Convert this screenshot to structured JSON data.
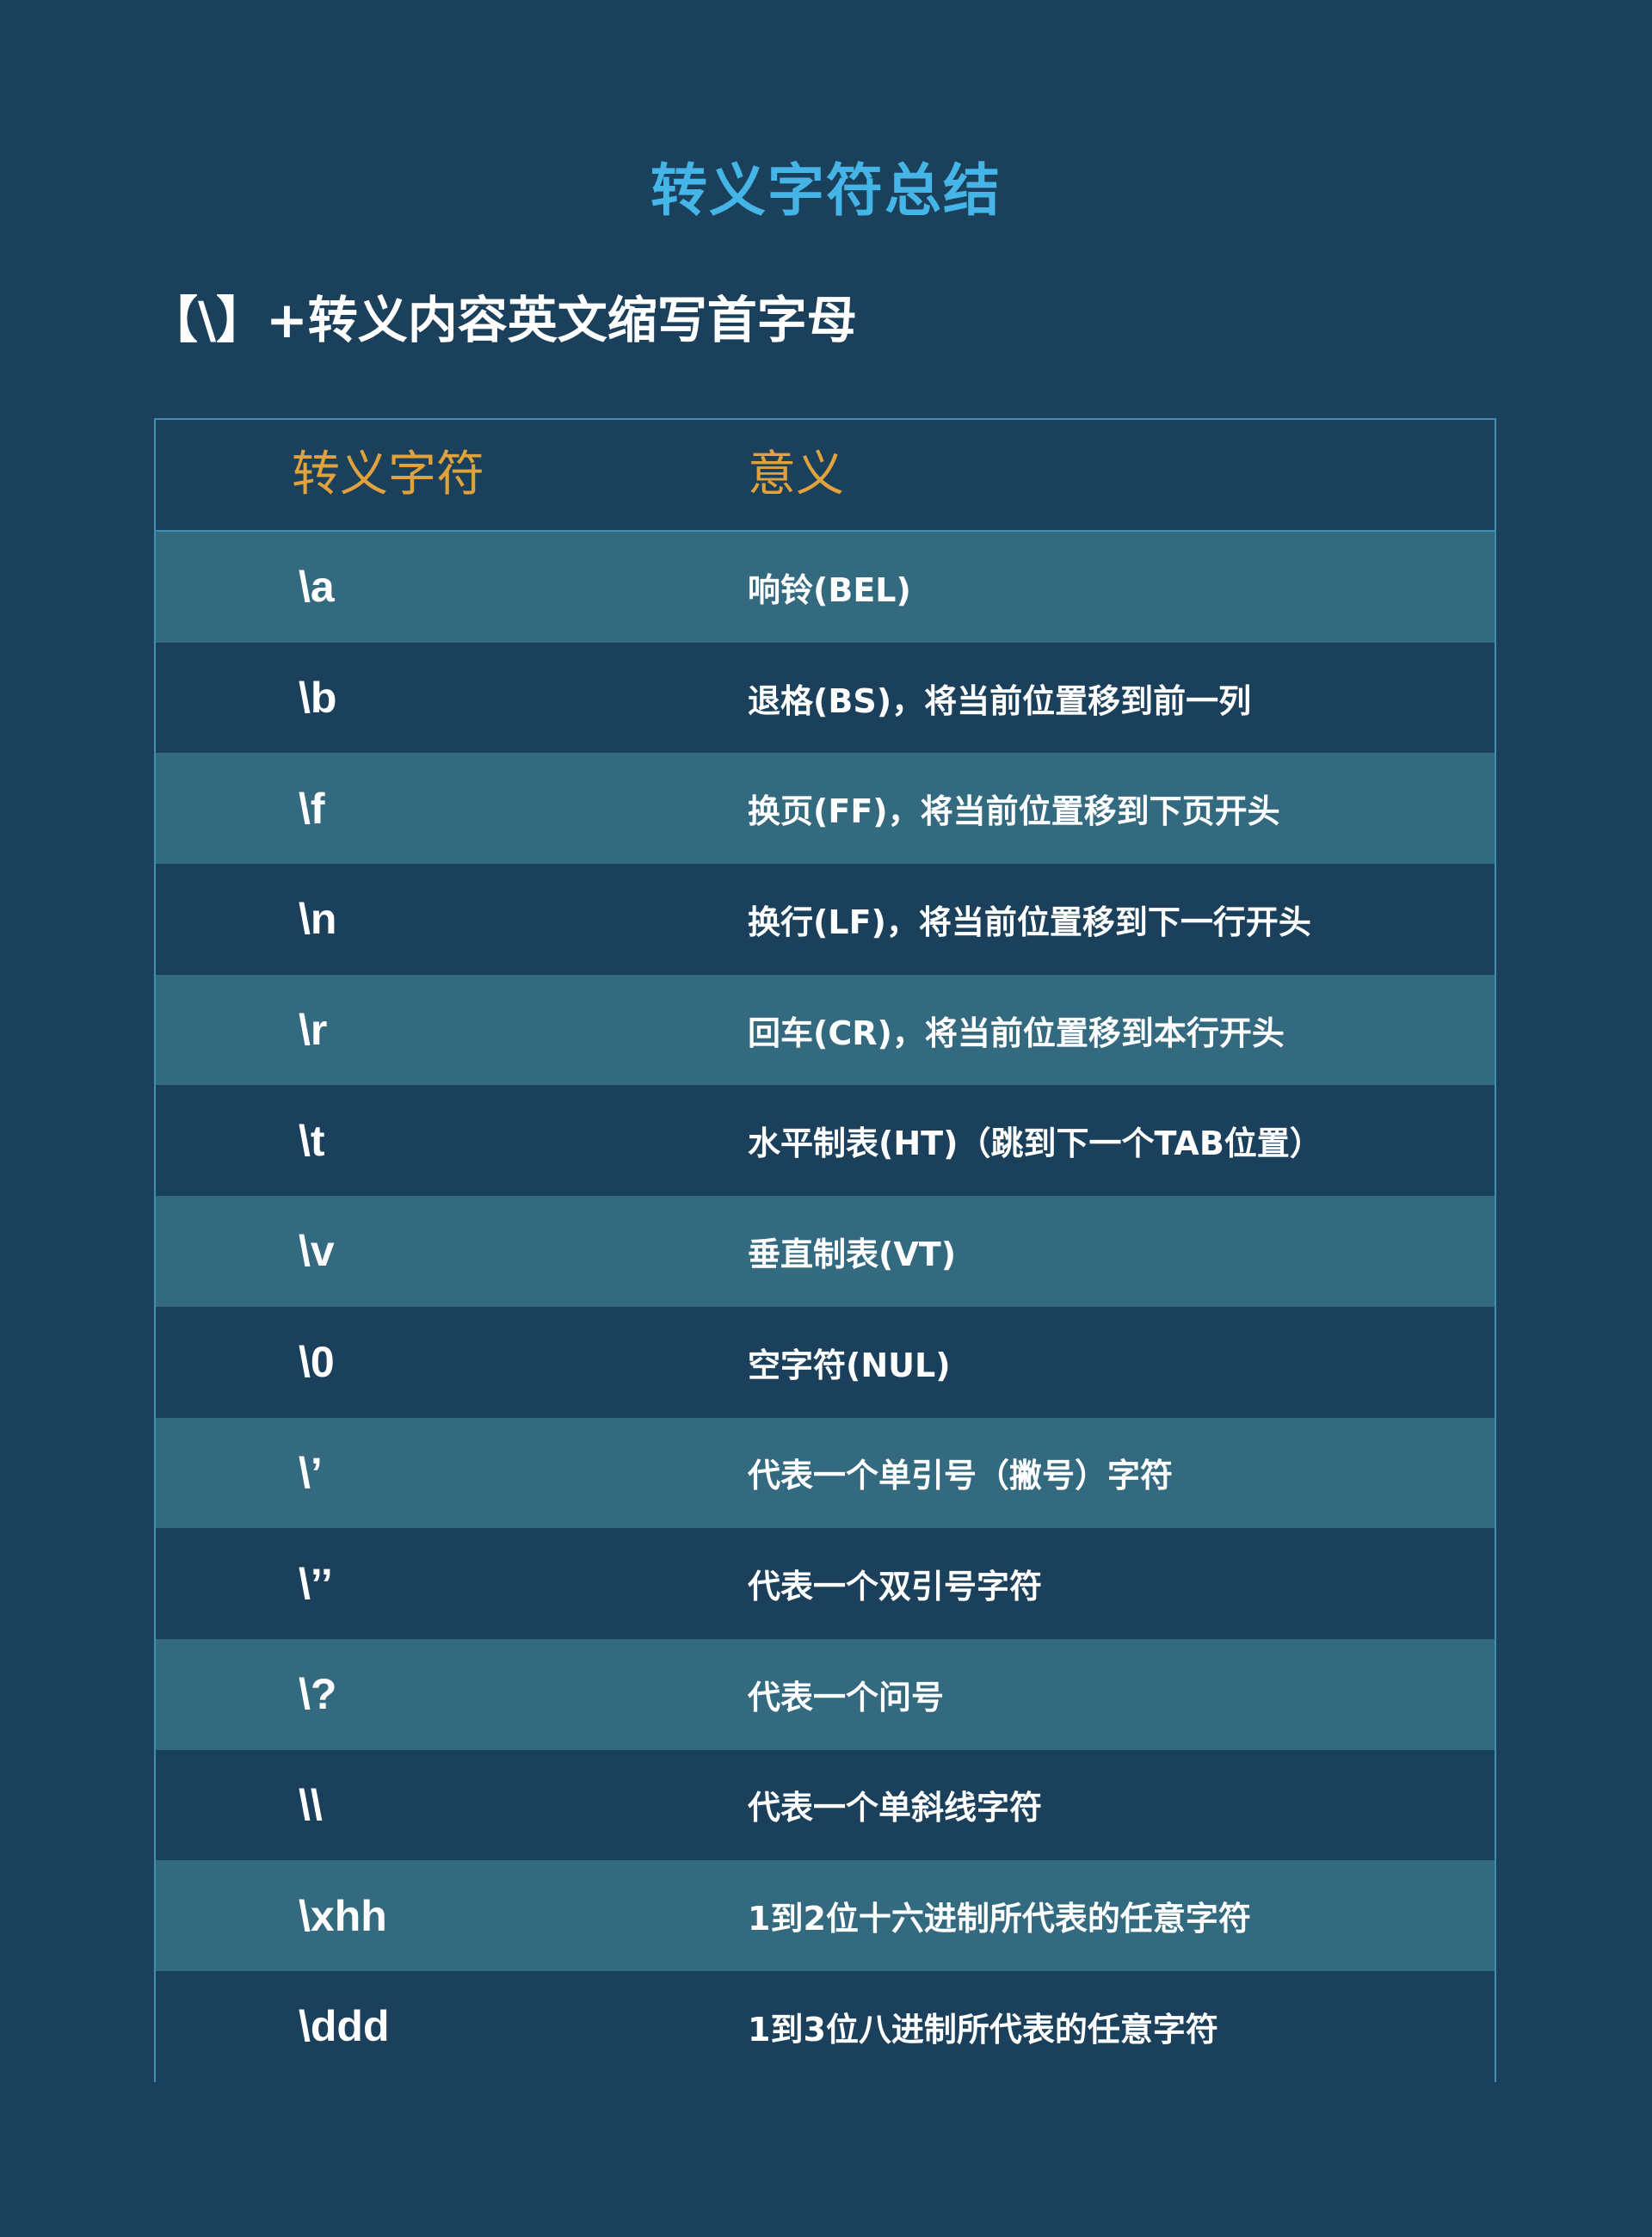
{
  "page": {
    "title": "转义字符总结",
    "subtitle": "【\\】+转义内容英文缩写首字母"
  },
  "colors": {
    "background": "#1b405b",
    "title": "#45b4e6",
    "header_text": "#e0a23c",
    "row_light": "#336a80",
    "row_dark": "#1b405b",
    "border": "#3e8fb1"
  },
  "table": {
    "headers": [
      "转义字符",
      "意义"
    ],
    "rows": [
      {
        "escape": "\\a",
        "meaning": "响铃(BEL)"
      },
      {
        "escape": "\\b",
        "meaning": "退格(BS)，将当前位置移到前一列"
      },
      {
        "escape": "\\f",
        "meaning": "换页(FF)，将当前位置移到下页开头"
      },
      {
        "escape": "\\n",
        "meaning": "换行(LF)，将当前位置移到下一行开头"
      },
      {
        "escape": "\\r",
        "meaning": "回车(CR)，将当前位置移到本行开头"
      },
      {
        "escape": "\\t",
        "meaning": "水平制表(HT)（跳到下一个TAB位置）"
      },
      {
        "escape": "\\v",
        "meaning": "垂直制表(VT)"
      },
      {
        "escape": "\\0",
        "meaning": "空字符(NUL)"
      },
      {
        "escape": "\\’",
        "meaning": "代表一个单引号（撇号）字符"
      },
      {
        "escape": "\\’’",
        "meaning": "代表一个双引号字符"
      },
      {
        "escape": "\\?",
        "meaning": "代表一个问号"
      },
      {
        "escape": "\\\\",
        "meaning": "代表一个单斜线字符"
      },
      {
        "escape": "\\xhh",
        "meaning": "1到2位十六进制所代表的任意字符"
      },
      {
        "escape": "\\ddd",
        "meaning": "1到3位八进制所代表的任意字符"
      }
    ]
  }
}
